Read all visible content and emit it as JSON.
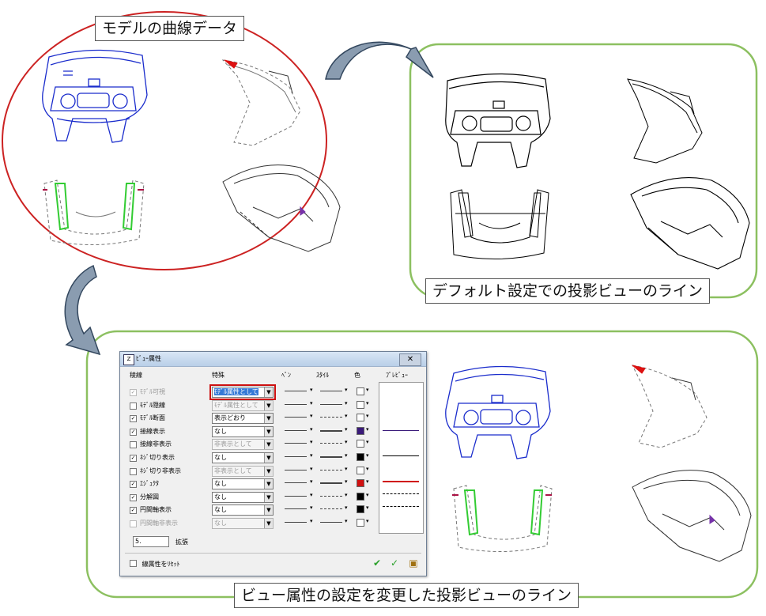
{
  "captions": {
    "model_curves": "モデルの曲線データ",
    "default_projection": "デフォルト設定での投影ビューのライン",
    "changed_projection": "ビュー属性の設定を変更した投影ビューのライン"
  },
  "dialog": {
    "title": "ﾋﾞｭｰ属性",
    "columns": {
      "line": "稜線",
      "special": "特殊",
      "pen": "ﾍﾟﾝ",
      "style": "ｽﾀｲﾙ",
      "color": "色",
      "preview": "ﾌﾟﾚﾋﾞｭｰ"
    },
    "rows": [
      {
        "label": "ﾓﾃﾞﾙ可視",
        "checked": true,
        "enabled": false,
        "special": "ﾓﾃﾞﾙ属性として",
        "special_enabled": true,
        "color": "#ffffff",
        "highlight": true
      },
      {
        "label": "ﾓﾃﾞﾙ隠線",
        "checked": false,
        "enabled": true,
        "special": "ﾓﾃﾞﾙ属性として",
        "special_enabled": false,
        "color": "#ffffff"
      },
      {
        "label": "ﾓﾃﾞﾙ断面",
        "checked": true,
        "enabled": true,
        "special": "表示どおり",
        "special_enabled": true,
        "color": "#ffffff"
      },
      {
        "label": "接線表示",
        "checked": true,
        "enabled": true,
        "special": "なし",
        "special_enabled": true,
        "color": "#3a1a7a"
      },
      {
        "label": "接線非表示",
        "checked": false,
        "enabled": true,
        "special": "非表示として",
        "special_enabled": false,
        "color": "#ffffff"
      },
      {
        "label": "ﾈｼﾞ切り表示",
        "checked": true,
        "enabled": true,
        "special": "なし",
        "special_enabled": true,
        "color": "#000000"
      },
      {
        "label": "ﾈｼﾞ切り非表示",
        "checked": false,
        "enabled": true,
        "special": "非表示として",
        "special_enabled": false,
        "color": "#ffffff"
      },
      {
        "label": "ｴｼﾞｭｸﾀ",
        "checked": true,
        "enabled": true,
        "special": "なし",
        "special_enabled": true,
        "color": "#d01010"
      },
      {
        "label": "分解図",
        "checked": true,
        "enabled": true,
        "special": "なし",
        "special_enabled": true,
        "color": "#000000"
      },
      {
        "label": "円間軸表示",
        "checked": true,
        "enabled": true,
        "special": "なし",
        "special_enabled": true,
        "color": "#000000"
      },
      {
        "label": "円間軸非表示",
        "checked": false,
        "enabled": false,
        "special": "なし",
        "special_enabled": false,
        "color": "#ffffff"
      }
    ],
    "scale_value": "5.",
    "scale_label": "拡張",
    "reset_label": "線属性をﾘｾｯﾄ"
  },
  "colors": {
    "model_ellipse": "#cc2222",
    "panel_border": "#8cc060",
    "model_blue": "#1a2ccc",
    "model_green": "#33cc33",
    "model_red": "#dd1111",
    "arrow_fill": "#8a9cb0"
  }
}
